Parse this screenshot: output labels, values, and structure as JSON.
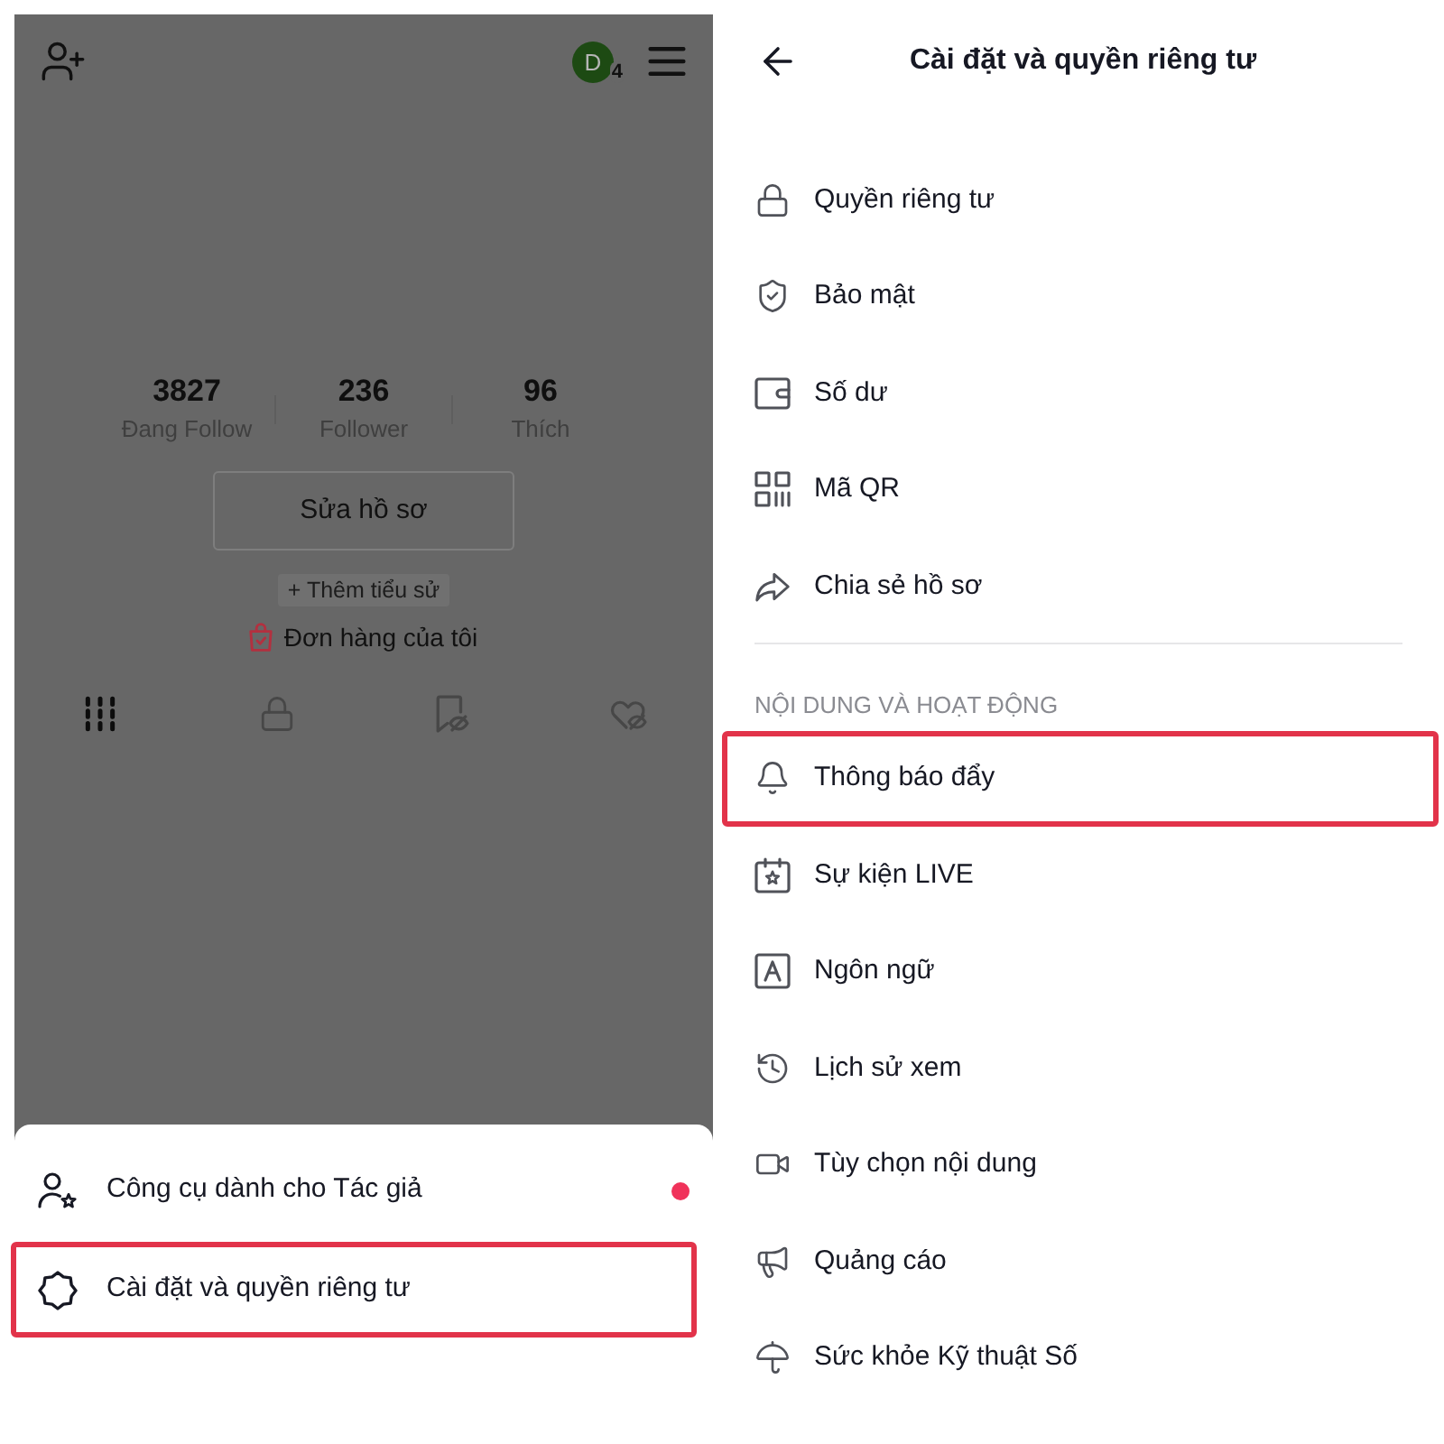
{
  "profile": {
    "avatar": {
      "initial": "D",
      "badge": "4"
    },
    "stats": [
      {
        "value": "3827",
        "label": "Đang Follow"
      },
      {
        "value": "236",
        "label": "Follower"
      },
      {
        "value": "96",
        "label": "Thích"
      }
    ],
    "edit_button": "Sửa hồ sơ",
    "add_bio_button": "+ Thêm tiểu sử",
    "orders_link": "Đơn hàng của tôi",
    "tabs": [
      {
        "selected": true
      },
      {
        "selected": false
      },
      {
        "selected": false
      },
      {
        "selected": false
      }
    ]
  },
  "bottom_sheet": {
    "items": [
      {
        "label": "Công cụ dành cho Tác giả",
        "notification_dot": true,
        "highlighted": false
      },
      {
        "label": "Cài đặt và quyền riêng tư",
        "notification_dot": false,
        "highlighted": true
      }
    ]
  },
  "settings": {
    "title": "Cài đặt và quyền riêng tư",
    "sections": [
      {
        "items": [
          {
            "label": "Quyền riêng tư",
            "highlighted": false
          },
          {
            "label": "Bảo mật",
            "highlighted": false
          },
          {
            "label": "Số dư",
            "highlighted": false
          },
          {
            "label": "Mã QR",
            "highlighted": false
          },
          {
            "label": "Chia sẻ hồ sơ",
            "highlighted": false
          }
        ]
      },
      {
        "heading": "NỘI DUNG VÀ HOẠT ĐỘNG",
        "items": [
          {
            "label": "Thông báo đẩy",
            "highlighted": true
          },
          {
            "label": "Sự kiện LIVE",
            "highlighted": false
          },
          {
            "label": "Ngôn ngữ",
            "highlighted": false
          },
          {
            "label": "Lịch sử xem",
            "highlighted": false
          },
          {
            "label": "Tùy chọn nội dung",
            "highlighted": false
          },
          {
            "label": "Quảng cáo",
            "highlighted": false
          },
          {
            "label": "Sức khỏe Kỹ thuật Số",
            "highlighted": false
          }
        ]
      }
    ]
  }
}
